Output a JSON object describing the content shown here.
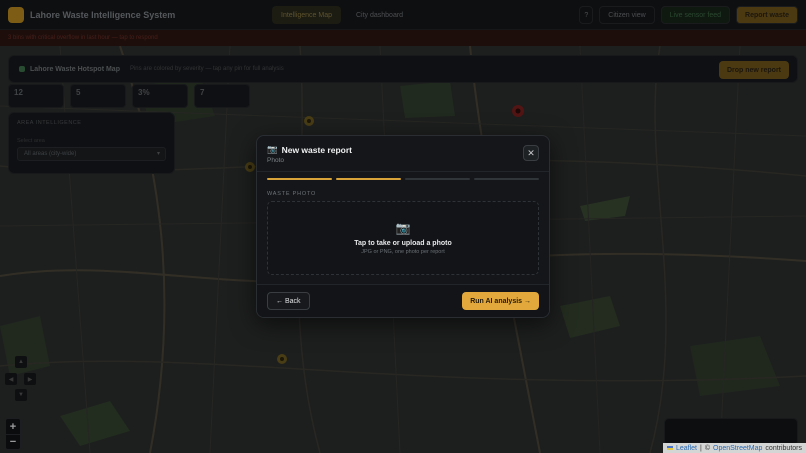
{
  "header": {
    "app_title": "Lahore Waste Intelligence System",
    "tabs": [
      "Intelligence Map",
      "City dashboard"
    ],
    "help_label": "?",
    "citizen_label": "Citizen view",
    "live_label": "Live sensor feed",
    "report_label": "Report waste"
  },
  "alert": {
    "text": "3 bins with critical overflow in last hour — tap to respond"
  },
  "hotspot_panel": {
    "title": "Lahore Waste Hotspot Map",
    "subtitle": "Pins are colored by severity — tap any pin for full analysis",
    "button": "Drop new report"
  },
  "stats": [
    {
      "value": "12"
    },
    {
      "value": "5"
    },
    {
      "value": "3%"
    },
    {
      "value": "7"
    }
  ],
  "intel_panel": {
    "label": "AREA INTELLIGENCE",
    "sublabel": "Select area",
    "select_value": "All areas (city-wide)"
  },
  "map": {
    "zoom_in": "+",
    "zoom_out": "−",
    "attribution_leaflet": "Leaflet",
    "attribution_sep": "|",
    "attribution_osm": "OpenStreetMap",
    "attribution_contrib": "contributors",
    "attribution_copy": "©"
  },
  "modal": {
    "title": "New waste report",
    "subtitle": "Photo",
    "title_icon": "camera-icon",
    "close_label": "✕",
    "steps_total": 4,
    "steps_completed": 2,
    "section_label": "WASTE PHOTO",
    "dropzone_title": "Tap to take or upload a photo",
    "dropzone_sub": "JPG or PNG, one photo per report",
    "back_label": "← Back",
    "run_label": "Run AI analysis →"
  },
  "colors": {
    "accent": "#e2a83b",
    "modal_bg": "#141619",
    "step_inactive": "#30353a"
  }
}
